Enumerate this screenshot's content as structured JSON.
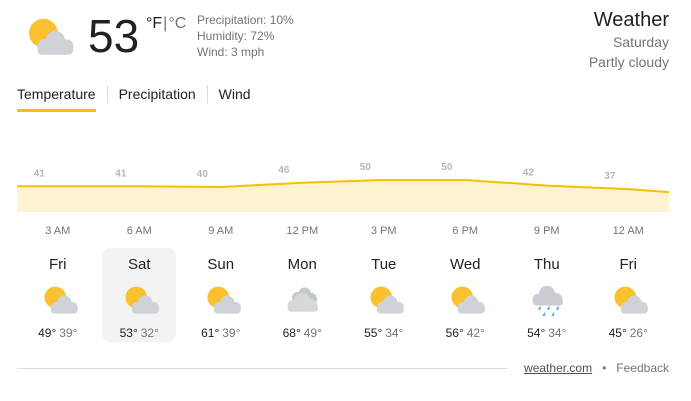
{
  "current": {
    "temperature": "53",
    "unit_f": "°F",
    "unit_sep": "|",
    "unit_c": "°C",
    "precipitation": "Precipitation: 10%",
    "humidity": "Humidity: 72%",
    "wind": "Wind: 3 mph",
    "icon": "partly-cloudy-icon"
  },
  "header": {
    "title": "Weather",
    "day": "Saturday",
    "condition": "Partly cloudy"
  },
  "tabs": [
    {
      "label": "Temperature",
      "active": true
    },
    {
      "label": "Precipitation",
      "active": false
    },
    {
      "label": "Wind",
      "active": false
    }
  ],
  "chart_data": {
    "type": "area",
    "categories": [
      "3 AM",
      "6 AM",
      "9 AM",
      "12 PM",
      "3 PM",
      "6 PM",
      "9 PM",
      "12 AM"
    ],
    "values": [
      41,
      41,
      40,
      46,
      50,
      50,
      42,
      37
    ],
    "line_color": "#f4c000",
    "fill_color": "#fdf3d0"
  },
  "days": [
    {
      "name": "Fri",
      "hi": "49°",
      "lo": "39°",
      "icon": "partly-cloudy-icon",
      "selected": false
    },
    {
      "name": "Sat",
      "hi": "53°",
      "lo": "32°",
      "icon": "partly-cloudy-icon",
      "selected": true
    },
    {
      "name": "Sun",
      "hi": "61°",
      "lo": "39°",
      "icon": "partly-cloudy-icon",
      "selected": false
    },
    {
      "name": "Mon",
      "hi": "68°",
      "lo": "49°",
      "icon": "cloudy-icon",
      "selected": false
    },
    {
      "name": "Tue",
      "hi": "55°",
      "lo": "34°",
      "icon": "partly-cloudy-icon",
      "selected": false
    },
    {
      "name": "Wed",
      "hi": "56°",
      "lo": "42°",
      "icon": "partly-cloudy-icon",
      "selected": false
    },
    {
      "name": "Thu",
      "hi": "54°",
      "lo": "34°",
      "icon": "rain-icon",
      "selected": false
    },
    {
      "name": "Fri",
      "hi": "45°",
      "lo": "26°",
      "icon": "partly-cloudy-icon",
      "selected": false
    }
  ],
  "footer": {
    "source": "weather.com",
    "separator": "•",
    "feedback": "Feedback"
  }
}
